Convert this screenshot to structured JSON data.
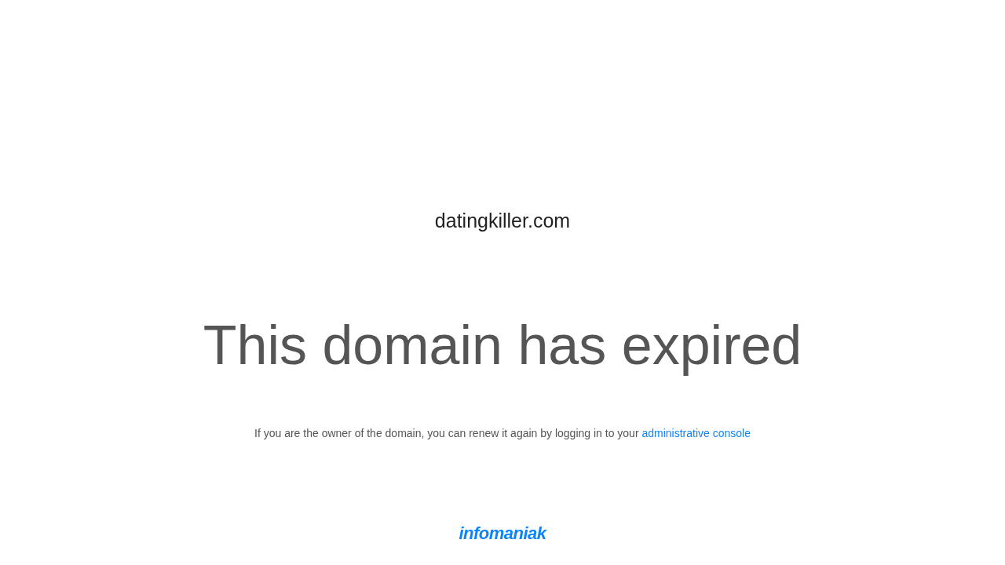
{
  "domain": "datingkiller.com",
  "headline": "This domain has expired",
  "message": {
    "text": "If you are the owner of the domain, you can renew it again by logging in to your",
    "link": "administrative console"
  },
  "footer": {
    "logo": "infomaniak"
  }
}
